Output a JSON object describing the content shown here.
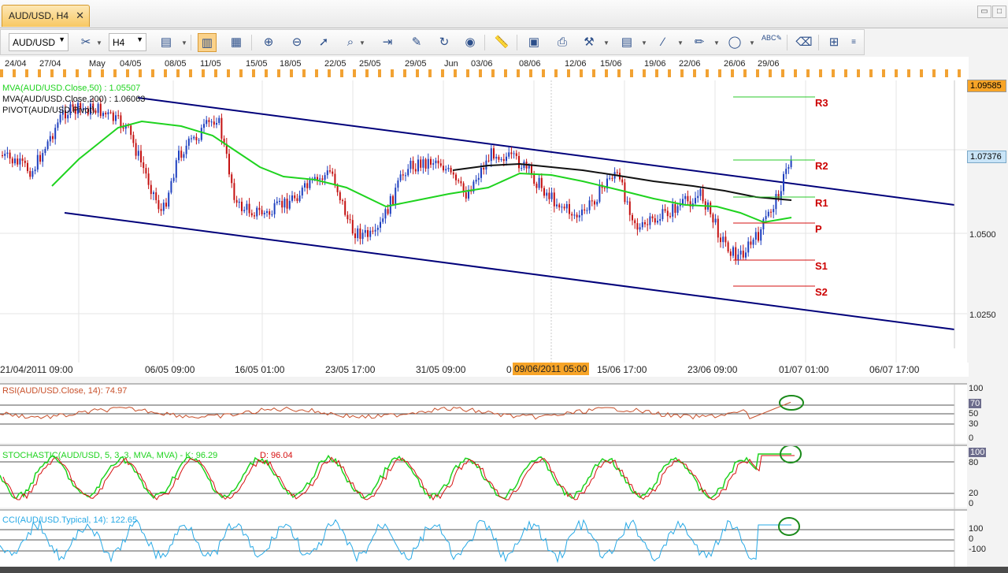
{
  "window": {
    "tab_title": "AUD/USD, H4",
    "close_glyph": "✕"
  },
  "toolbar": {
    "symbol": "AUD/USD",
    "timeframe": "H4"
  },
  "dates_top": [
    "24/04",
    "27/04",
    "May",
    "04/05",
    "08/05",
    "11/05",
    "15/05",
    "18/05",
    "22/05",
    "25/05",
    "29/05",
    "Jun",
    "03/06",
    "08/06",
    "12/06",
    "15/06",
    "19/06",
    "22/06",
    "26/06",
    "29/06"
  ],
  "price_chart": {
    "legend": [
      {
        "text": "MVA(AUD/USD.Close,50) : 1.05507",
        "color": "#1fd31f"
      },
      {
        "text": "MVA(AUD/USD.Close,200) : 1.06063",
        "color": "#111111"
      },
      {
        "text": "PIVOT(AUD/USD.Pivot)",
        "color": "#111111"
      }
    ],
    "y_labels": [
      "1.0500",
      "1.0250"
    ],
    "top_price": "1.09585",
    "current_price": "1.07376",
    "pivots": [
      "R3",
      "R2",
      "R1",
      "P",
      "S1",
      "S2"
    ]
  },
  "time_axis": [
    "21/04/2011 09:00",
    "06/05 09:00",
    "16/05 01:00",
    "23/05 17:00",
    "31/05 09:00",
    "0",
    "09/06/2011 05:00",
    "15/06 17:00",
    "23/06 09:00",
    "01/07 01:00",
    "06/07 17:00"
  ],
  "rsi": {
    "label": "RSI(AUD/USD.Close, 14): 74.97",
    "color": "#c8502a",
    "levels": [
      "100",
      "70",
      "50",
      "30",
      "0"
    ]
  },
  "stochastic": {
    "label_a": "STOCHASTIC(AUD/USD, 5, 3, 3, MVA, MVA) - K: 96.29",
    "label_b": "D: 96.04",
    "levels": [
      "100",
      "80",
      "20",
      "0"
    ]
  },
  "cci": {
    "label": "CCI(AUD/USD.Typical, 14): 122.65",
    "color": "#27a9e6",
    "levels": [
      "100",
      "0",
      "-100"
    ]
  },
  "colors": {
    "channel": "#00007a",
    "ma50": "#1fd31f",
    "ma200": "#111111",
    "pivot_green": "#28c828",
    "pivot_red": "#d61010",
    "bull": "#1e3fbf",
    "bear": "#c41010"
  }
}
